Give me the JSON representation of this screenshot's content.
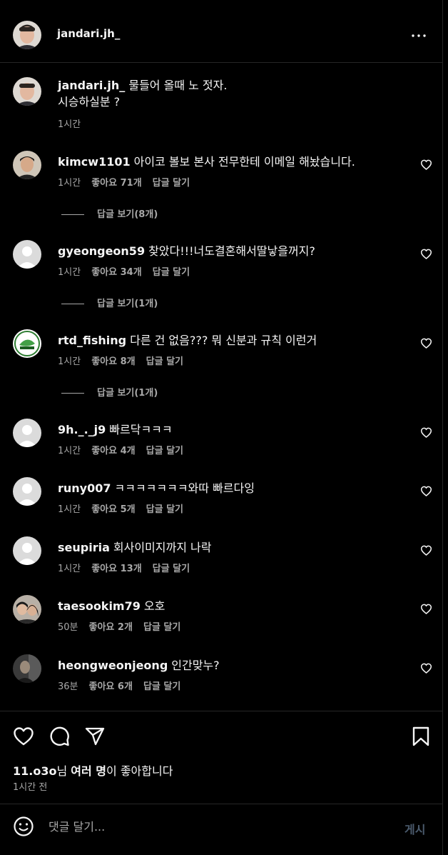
{
  "header": {
    "username": "jandari.jh_",
    "more_icon": "more-horizontal-icon"
  },
  "caption": {
    "username": "jandari.jh_",
    "line1": "물들어 올때 노 젓자.",
    "line2": "시승하실분 ?",
    "time": "1시간"
  },
  "comments": [
    {
      "username": "kimcw1101",
      "text": "아이코 볼보 본사 전무한테 이메일 해놨습니다.",
      "time": "1시간",
      "likes": "좋아요 71개",
      "reply": "답글 달기",
      "view_replies": "답글 보기(8개)"
    },
    {
      "username": "gyeongeon59",
      "text": "찾았다!!!너도결혼해서딸낳을꺼지?",
      "time": "1시간",
      "likes": "좋아요 34개",
      "reply": "답글 달기",
      "view_replies": "답글 보기(1개)"
    },
    {
      "username": "rtd_fishing",
      "text": "다른 건 없음??? 뭐 신분과 규칙 이런거",
      "time": "1시간",
      "likes": "좋아요 8개",
      "reply": "답글 달기",
      "view_replies": "답글 보기(1개)"
    },
    {
      "username": "9h._._j9",
      "text": "빠르닥ㅋㅋㅋ",
      "time": "1시간",
      "likes": "좋아요 4개",
      "reply": "답글 달기"
    },
    {
      "username": "runy007",
      "text": "ㅋㅋㅋㅋㅋㅋㅋ와따 빠르다잉",
      "time": "1시간",
      "likes": "좋아요 5개",
      "reply": "답글 달기"
    },
    {
      "username": "seupiria",
      "text": "회사이미지까지 나락",
      "time": "1시간",
      "likes": "좋아요 13개",
      "reply": "답글 달기"
    },
    {
      "username": "taesookim79",
      "text": "오호",
      "time": "50분",
      "likes": "좋아요 2개",
      "reply": "답글 달기"
    },
    {
      "username": "heongweonjeong",
      "text": "인간맞누?",
      "time": "36분",
      "likes": "좋아요 6개",
      "reply": "답글 달기"
    }
  ],
  "actions": {
    "like_icon": "heart-icon",
    "comment_icon": "comment-icon",
    "share_icon": "send-icon",
    "save_icon": "bookmark-icon",
    "liked_by_user": "11.o3o",
    "liked_by_mid": "님 ",
    "liked_by_others": "여러 명",
    "liked_by_tail": "이 좋아합니다",
    "post_time": "1시간 전"
  },
  "comment_box": {
    "emoji_icon": "emoji-icon",
    "placeholder": "댓글 달기...",
    "post_label": "게시"
  },
  "colors": {
    "background": "#000000",
    "text": "#f5f5f5",
    "secondary_text": "#a8a8a8",
    "divider": "#262626",
    "post_button_disabled": "#4b5b6d"
  }
}
